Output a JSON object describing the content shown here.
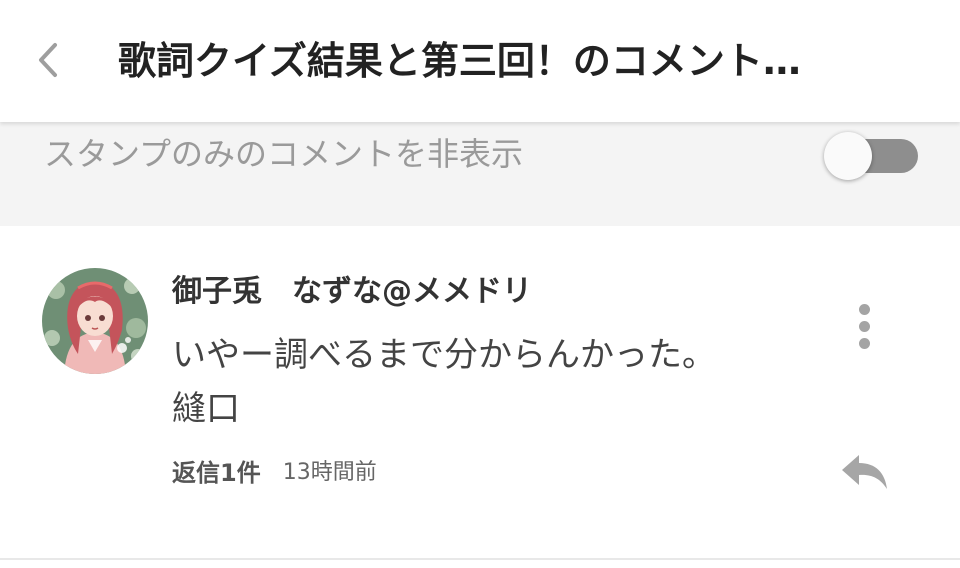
{
  "header": {
    "back_icon": "chevron-left-icon",
    "title": "歌詞クイズ結果と第三回！のコメント…"
  },
  "filter": {
    "label": "スタンプのみのコメントを非表示",
    "toggle_on": false,
    "toggle_track_color": "#8e8e8e",
    "toggle_knob_color": "#fafafa"
  },
  "comment": {
    "author": "御子兎　なずな@メメドリ",
    "text_lines": [
      "いやー調べるまで分からんかった。",
      "縫口"
    ],
    "reply_count_label": "返信1件",
    "timestamp": "13時間前",
    "more_icon": "more-vertical-icon",
    "reply_icon": "reply-arrow-icon"
  },
  "colors": {
    "header_bg": "#ffffff",
    "filter_bg": "#f4f4f4",
    "icon_gray": "#a4a4a4",
    "avatar_bg": "#6e8e74"
  }
}
